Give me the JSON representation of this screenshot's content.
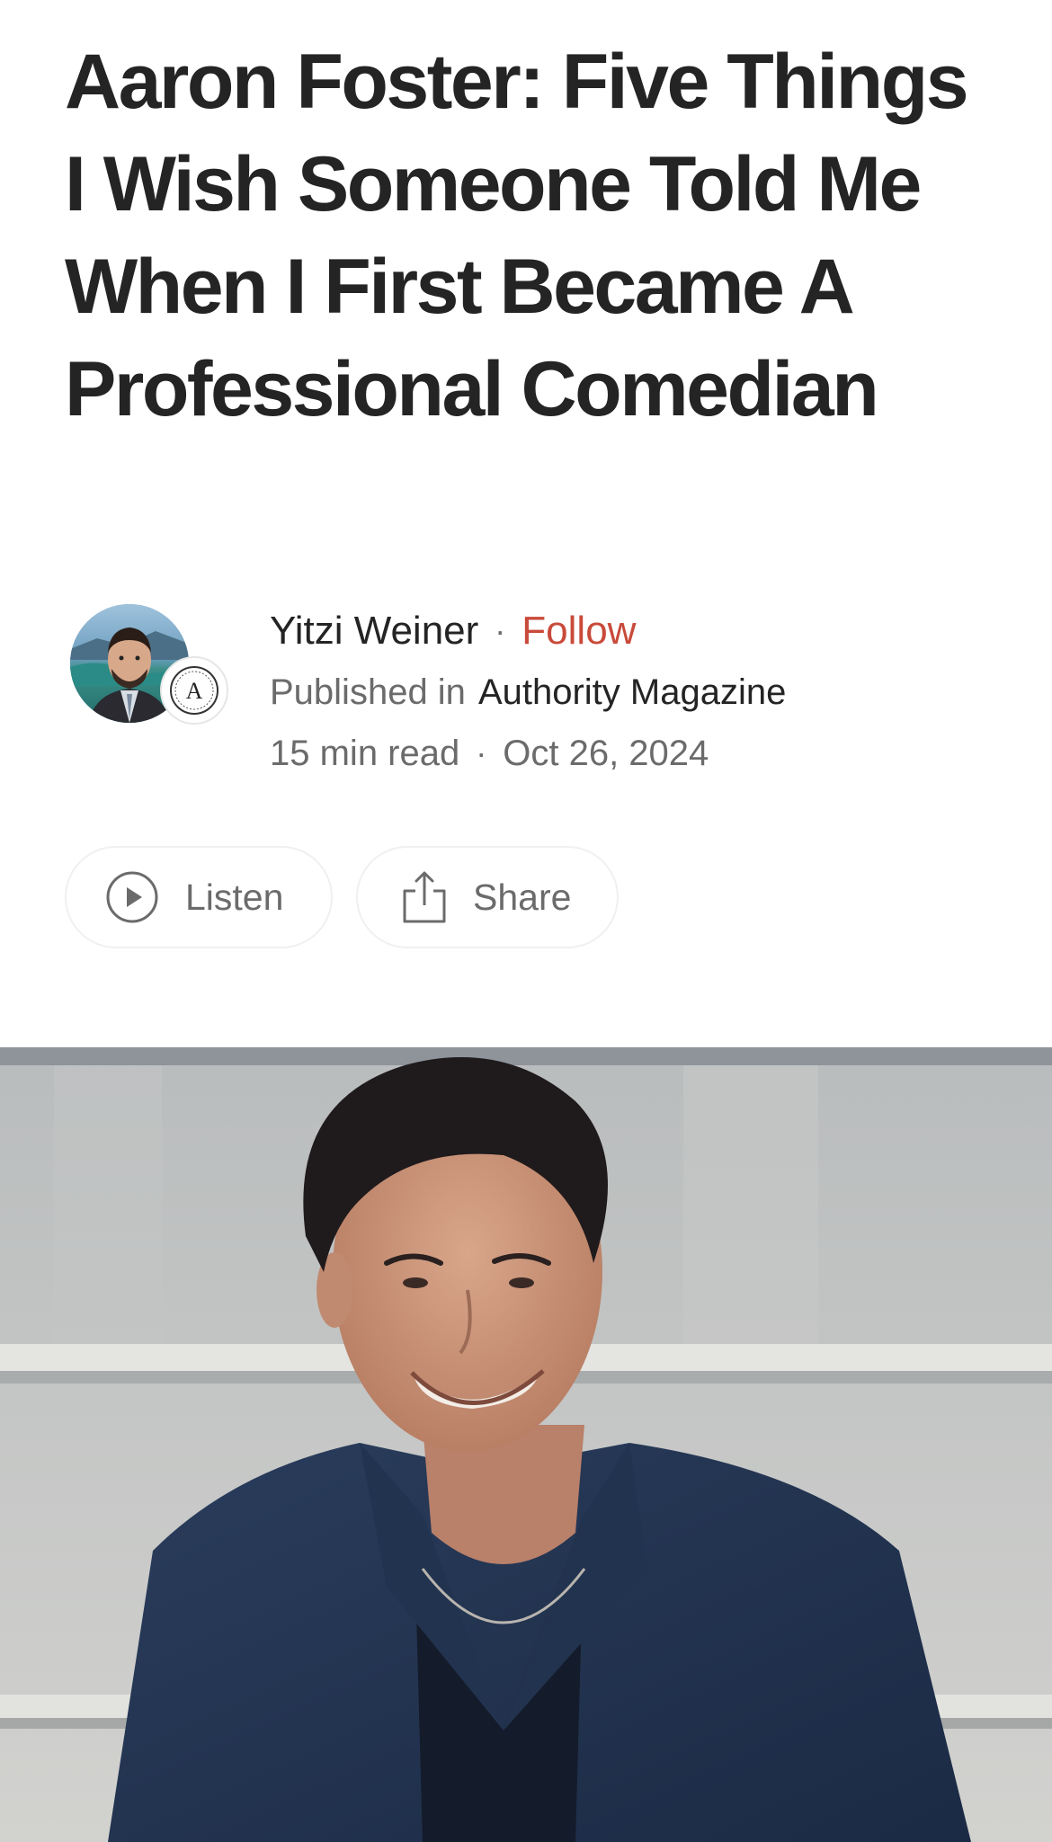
{
  "article": {
    "title": "Aaron Foster: Five Things I Wish Someone Told Me When I First Became A Professional Comedian"
  },
  "author": {
    "name": "Yitzi Weiner",
    "separator": "·",
    "follow_label": "Follow",
    "published_prefix": "Published in",
    "publication": "Authority Magazine",
    "publication_badge_letter": "A",
    "read_time": "15 min read",
    "date": "Oct 26, 2024"
  },
  "actions": {
    "listen_label": "Listen",
    "share_label": "Share"
  },
  "icons": {
    "listen": "play-circle-icon",
    "share": "share-icon"
  },
  "colors": {
    "text_primary": "#242424",
    "text_secondary": "#6b6b6b",
    "follow_accent": "#c94a3a",
    "pill_border": "#f0f0f0"
  }
}
